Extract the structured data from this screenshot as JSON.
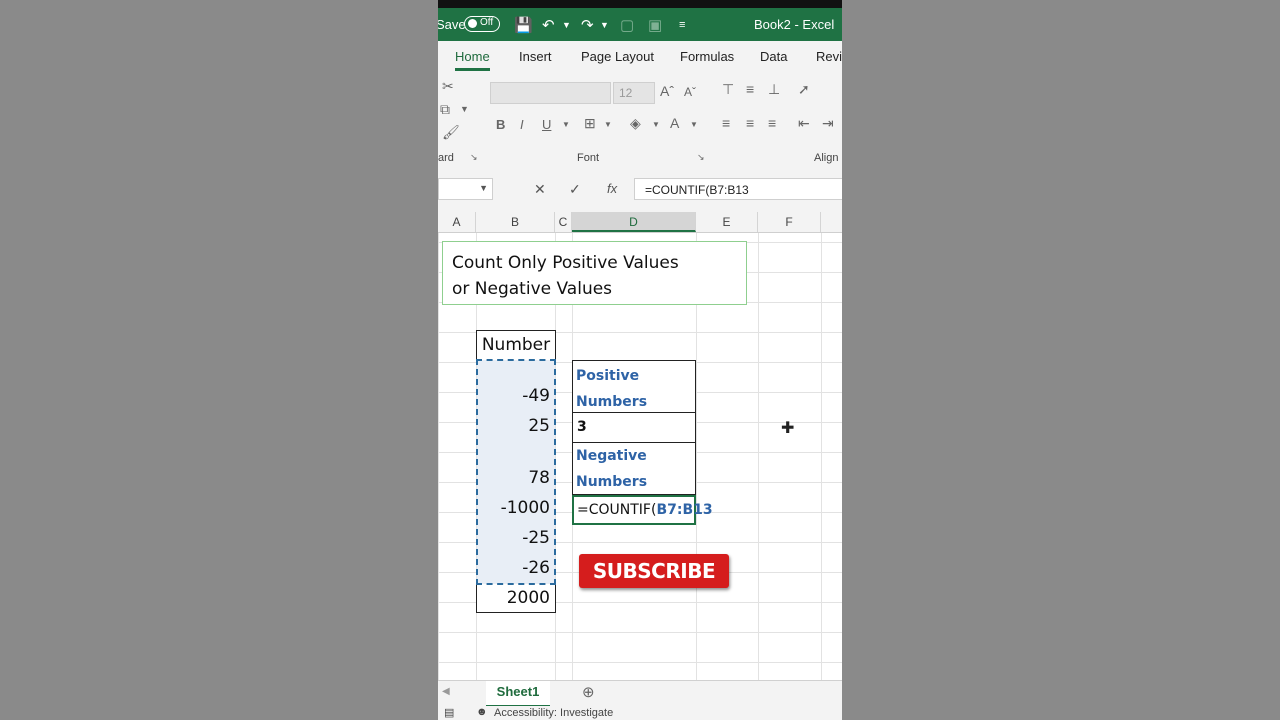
{
  "titlebar": {
    "save_label": "Save",
    "autosave_state": "Off",
    "doc_title": "Book2 - Excel",
    "brand_color": "#1f7244"
  },
  "ribbon_tabs": [
    "Home",
    "Insert",
    "Page Layout",
    "Formulas",
    "Data",
    "Revi"
  ],
  "ribbon": {
    "font_size": "12",
    "clipboard_group": "ard",
    "font_group": "Font",
    "alignment_group": "Align"
  },
  "formula_bar": {
    "formula": "=COUNTIF(B7:B13"
  },
  "columns": [
    "A",
    "B",
    "C",
    "D",
    "E",
    "F"
  ],
  "sheet": {
    "title_line1": "Count Only Positive Values",
    "title_line2": "or Negative Values",
    "number_header": "Number",
    "numbers": [
      "-49",
      "25",
      "78",
      "-1000",
      "-25",
      "-26",
      "2000"
    ],
    "positive_label_1": "Positive",
    "positive_label_2": "Numbers",
    "positive_result": "3",
    "negative_label_1": "Negative",
    "negative_label_2": "Numbers",
    "editing_formula_prefix": "=COUNTIF(",
    "editing_formula_range": "B7:B13",
    "subscribe_label": "SUBSCRIBE"
  },
  "sheet_tabs": [
    "Sheet1"
  ],
  "status_bar": {
    "accessibility": "Accessibility: Investigate"
  }
}
